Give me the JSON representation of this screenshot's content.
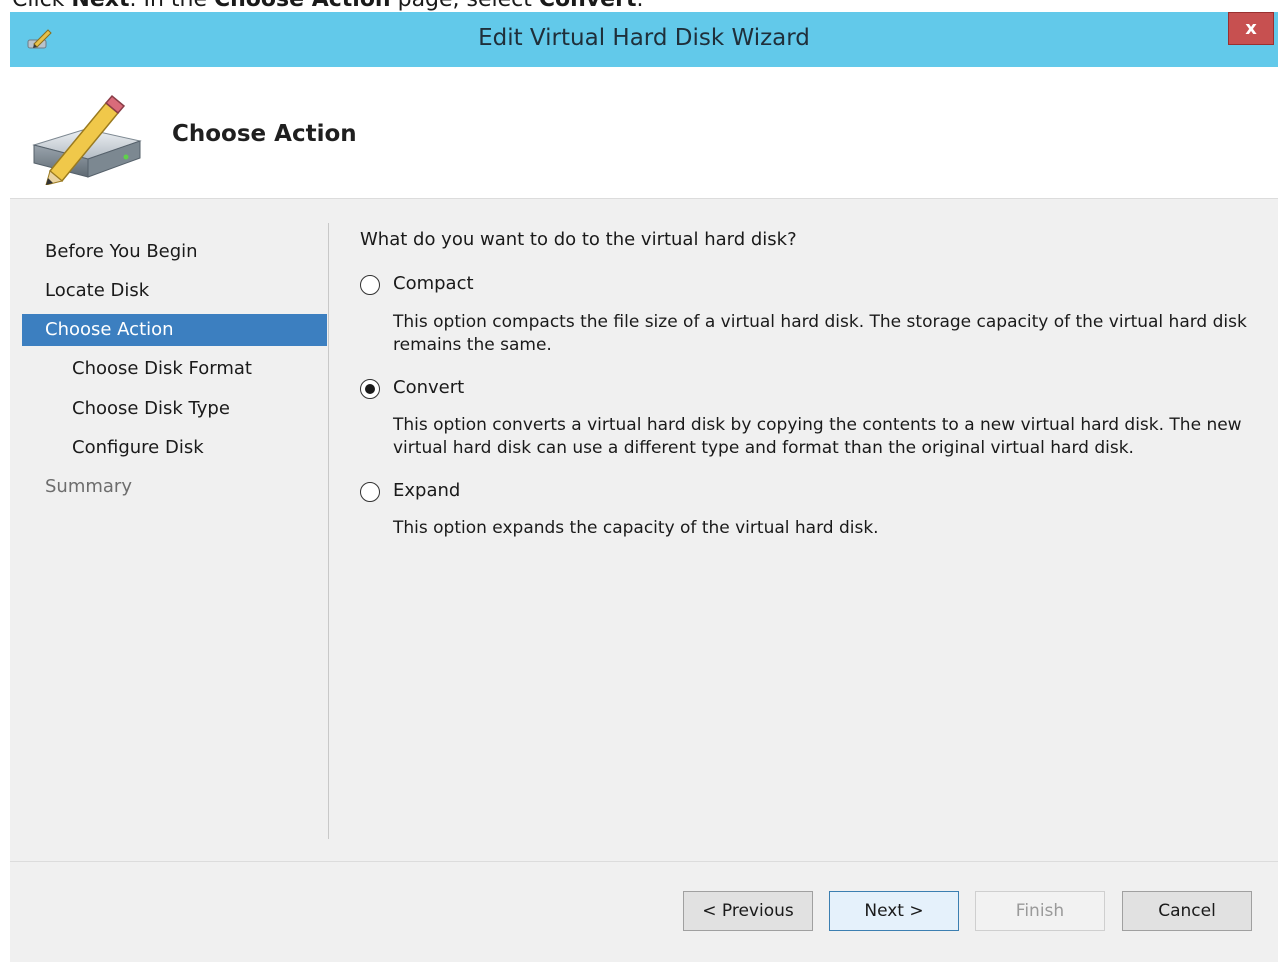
{
  "instruction": {
    "prefix": "Click ",
    "next": "Next",
    "middle": ". In the ",
    "page": "Choose Action",
    "middle2": " page, select ",
    "action": "Convert",
    "suffix": "."
  },
  "window": {
    "title": "Edit Virtual Hard Disk Wizard",
    "close_label": "x"
  },
  "header": {
    "title": "Choose Action",
    "icon": "hard-disk-pencil-icon"
  },
  "nav": {
    "items": [
      {
        "label": "Before You Begin",
        "state": "normal"
      },
      {
        "label": "Locate Disk",
        "state": "normal"
      },
      {
        "label": "Choose Action",
        "state": "active"
      },
      {
        "label": "Choose Disk Format",
        "state": "sub"
      },
      {
        "label": "Choose Disk Type",
        "state": "sub"
      },
      {
        "label": "Configure Disk",
        "state": "sub"
      },
      {
        "label": "Summary",
        "state": "disabled"
      }
    ]
  },
  "content": {
    "question": "What do you want to do to the virtual hard disk?",
    "options": [
      {
        "label": "Compact",
        "checked": false,
        "description": "This option compacts the file size of a virtual hard disk. The storage capacity of the virtual hard disk remains the same."
      },
      {
        "label": "Convert",
        "checked": true,
        "description": "This option converts a virtual hard disk by copying the contents to a new virtual hard disk. The new virtual hard disk can use a different type and format than the original virtual hard disk."
      },
      {
        "label": "Expand",
        "checked": false,
        "description": "This option expands the capacity of the virtual hard disk."
      }
    ]
  },
  "footer": {
    "previous": "< Previous",
    "next": "Next >",
    "finish": "Finish",
    "cancel": "Cancel"
  },
  "colors": {
    "titlebar": "#62c9ea",
    "selection": "#3c7fc0",
    "close": "#c75050"
  }
}
